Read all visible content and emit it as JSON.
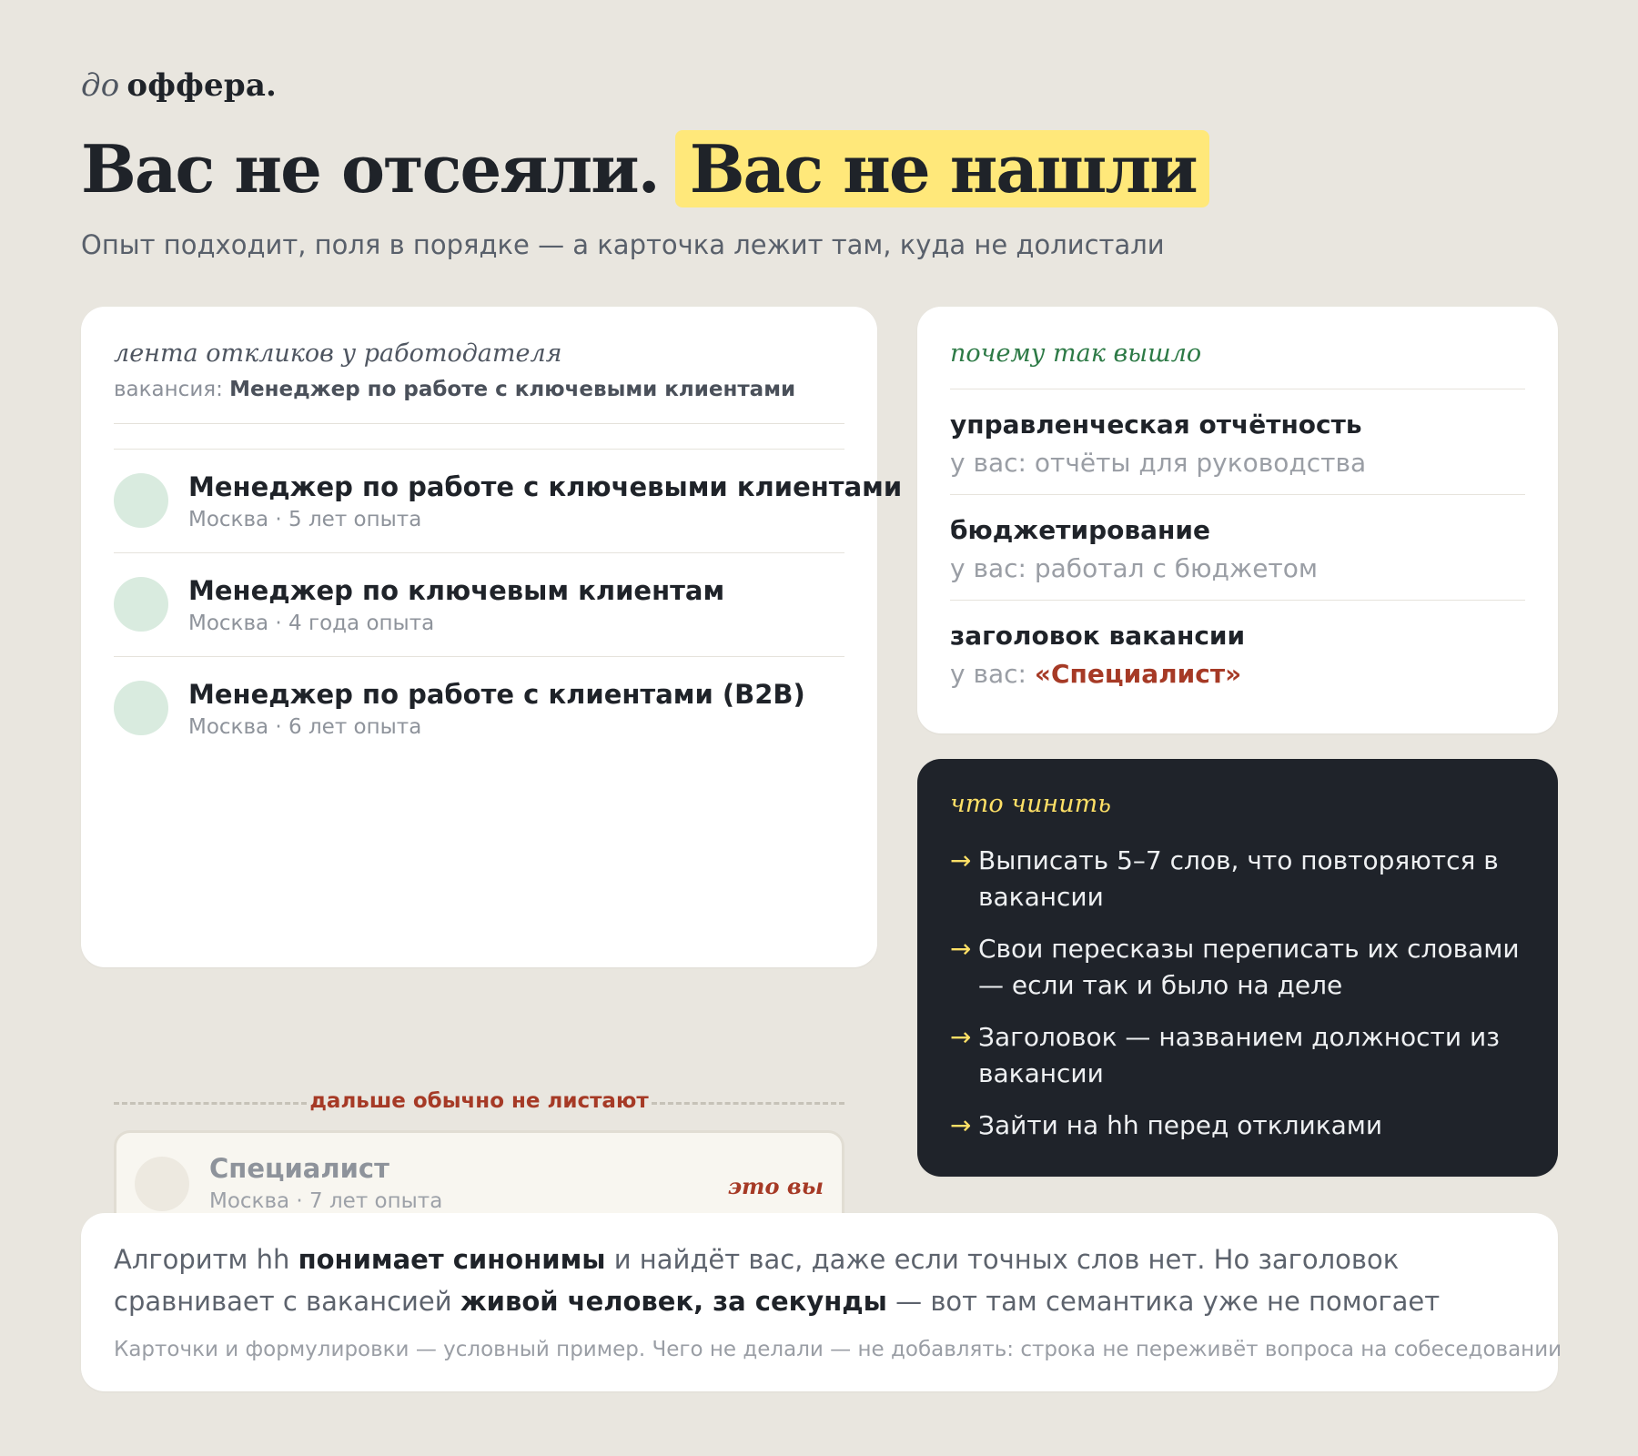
{
  "brand": {
    "prefix": "до",
    "name": "оффера."
  },
  "headline": {
    "part1": "Вас не отсеяли.",
    "highlight": "Вас не нашли"
  },
  "subtitle": "Опыт подходит, поля в порядке — а карточка лежит там, куда не долистали",
  "feed": {
    "kicker": "лента откликов у работодателя",
    "vacancy_label": "вакансия:",
    "vacancy_title": "Менеджер по работе с ключевыми клиентами",
    "items": [
      {
        "title": "Менеджер по работе с ключевыми клиентами",
        "meta": "Москва · 5 лет опыта"
      },
      {
        "title": "Менеджер по ключевым клиентам",
        "meta": "Москва · 4 года опыта"
      },
      {
        "title": "Менеджер по работе с клиентами (B2B)",
        "meta": "Москва · 6 лет опыта"
      }
    ],
    "cutoff_label": "дальше обычно не листают",
    "you": {
      "title": "Специалист",
      "meta": "Москва · 7 лет опыта",
      "tag": "это вы"
    }
  },
  "why": {
    "kicker": "почему так вышло",
    "items": [
      {
        "term": "управленческая отчётность",
        "you_label": "у вас:",
        "you_value": "отчёты для руководства"
      },
      {
        "term": "бюджетирование",
        "you_label": "у вас:",
        "you_value": "работал с бюджетом"
      },
      {
        "term": "заголовок вакансии",
        "you_label": "у вас:",
        "you_value": "«Специалист»"
      }
    ]
  },
  "fix": {
    "kicker": "что чинить",
    "arrow": "→",
    "steps": [
      "Выписать 5–7 слов, что повторяются в вакансии",
      "Свои пересказы переписать их словами — если так и было на деле",
      "Заголовок — названием должности из вакансии",
      "Зайти на hh перед откликами"
    ]
  },
  "note": {
    "t1": "Алгоритм hh ",
    "b1": "понимает синонимы",
    "t2": " и найдёт вас, даже если точных слов нет. Но заголовок сравнивает с вакансией ",
    "b2": "живой человек, за секунды",
    "t3": " — вот там семантика уже не помогает",
    "disclaimer": "Карточки и формулировки — условный пример. Чего не делали — не добавлять: строка не переживёт вопроса на собеседовании"
  },
  "colors": {
    "background": "#e9e6df",
    "highlight": "#ffe87a",
    "accent_red": "#a63a26",
    "accent_green": "#2d7a46",
    "dark_card": "#1f232a",
    "accent_yellow": "#ffe066"
  }
}
